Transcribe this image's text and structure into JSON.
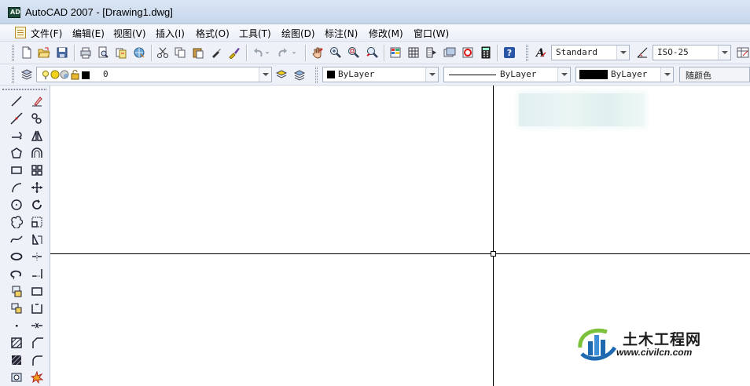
{
  "window": {
    "title": "AutoCAD 2007 - [Drawing1.dwg]",
    "app_icon": "autocad-logo-icon"
  },
  "menu": {
    "items": [
      {
        "label": "文件(F)"
      },
      {
        "label": "编辑(E)"
      },
      {
        "label": "视图(V)"
      },
      {
        "label": "插入(I)"
      },
      {
        "label": "格式(O)"
      },
      {
        "label": "工具(T)"
      },
      {
        "label": "绘图(D)"
      },
      {
        "label": "标注(N)"
      },
      {
        "label": "修改(M)"
      },
      {
        "label": "窗口(W)"
      }
    ]
  },
  "standard_toolbar": {
    "icons": [
      "new-icon",
      "open-icon",
      "save-icon",
      "plot-icon",
      "plot-preview-icon",
      "publish-icon",
      "3d-dwf-icon",
      "cut-icon",
      "copy-icon",
      "paste-icon",
      "matchprop-icon",
      "brush-icon",
      "undo-icon",
      "redo-icon",
      "pan-icon",
      "zoom-realtime-icon",
      "zoom-window-icon",
      "zoom-previous-icon",
      "properties-icon",
      "design-center-icon",
      "tool-palettes-icon",
      "sheet-set-icon",
      "markup-icon",
      "calculator-icon",
      "help-icon"
    ]
  },
  "styles_toolbar": {
    "text_style": "Standard",
    "dim_style": "ISO-25"
  },
  "layers_toolbar": {
    "current_layer": "0"
  },
  "properties_toolbar": {
    "color": "ByLayer",
    "linetype": "ByLayer",
    "lineweight": "ByLayer",
    "plot_style": "随颜色"
  },
  "draw_toolbar": {
    "icons": [
      "line-icon",
      "construction-line-icon",
      "polyline-icon",
      "polygon-icon",
      "rectangle-icon",
      "arc-icon",
      "circle-icon",
      "revision-cloud-icon",
      "spline-icon",
      "ellipse-icon",
      "ellipse-arc-icon",
      "insert-block-icon",
      "make-block-icon",
      "point-icon",
      "hatch-icon",
      "gradient-icon",
      "region-icon"
    ]
  },
  "modify_toolbar": {
    "icons": [
      "erase-icon",
      "copy-object-icon",
      "mirror-icon",
      "offset-icon",
      "array-icon",
      "move-icon",
      "rotate-icon",
      "scale-icon",
      "stretch-icon",
      "trim-icon",
      "extend-icon",
      "break-at-point-icon",
      "break-icon",
      "join-icon",
      "chamfer-icon",
      "fillet-icon",
      "explode-icon"
    ]
  },
  "watermark": {
    "name": "土木工程网",
    "url": "www.civilcn.com"
  },
  "colors": {
    "toolbar_bg": "#eef2f8",
    "canvas_bg": "#ffffff",
    "title_bg": "#c6d7ec"
  }
}
